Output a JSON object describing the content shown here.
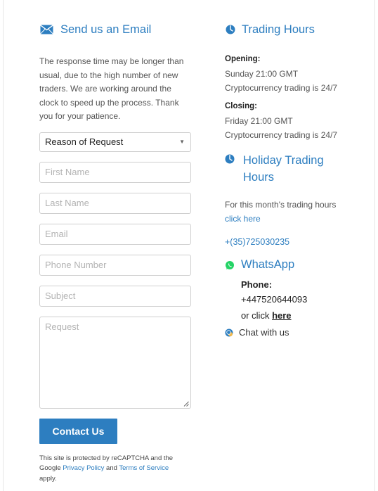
{
  "email_section": {
    "title": "Send us an Email",
    "intro": "The response time may be longer than usual, due to the high number of new traders. We are working around the clock to speed up the process. Thank you for your patience.",
    "reason_select": {
      "value": "Reason of Request"
    },
    "placeholders": {
      "first_name": "First Name",
      "last_name": "Last Name",
      "email": "Email",
      "phone": "Phone Number",
      "subject": "Subject",
      "request": "Request"
    },
    "submit_label": "Contact Us",
    "recaptcha": {
      "text1": "This site is protected by reCAPTCHA and the Google",
      "privacy_link": "Privacy Policy",
      "and": "and",
      "terms_link": "Terms of Service",
      "text2": "apply."
    }
  },
  "trading_hours": {
    "title": "Trading Hours",
    "opening_label": "Opening:",
    "opening_time": "Sunday 21:00 GMT",
    "opening_note": "Cryptocurrency trading is 24/7",
    "closing_label": "Closing:",
    "closing_time": "Friday 21:00 GMT",
    "closing_note": "Cryptocurrency trading is 24/7"
  },
  "holiday_hours": {
    "title_line1": "Holiday Trading",
    "title_line2": "Hours",
    "text": "For this month's trading hours",
    "link": "click here"
  },
  "phone_number": "+(35)725030235",
  "whatsapp": {
    "title": "WhatsApp",
    "phone_label": "Phone:",
    "phone": "+447520644093",
    "or_click": "or click",
    "here_link": "here"
  },
  "chat": {
    "label": "Chat with us"
  },
  "colors": {
    "accent": "#2d7ec0",
    "whatsapp": "#25d366"
  }
}
